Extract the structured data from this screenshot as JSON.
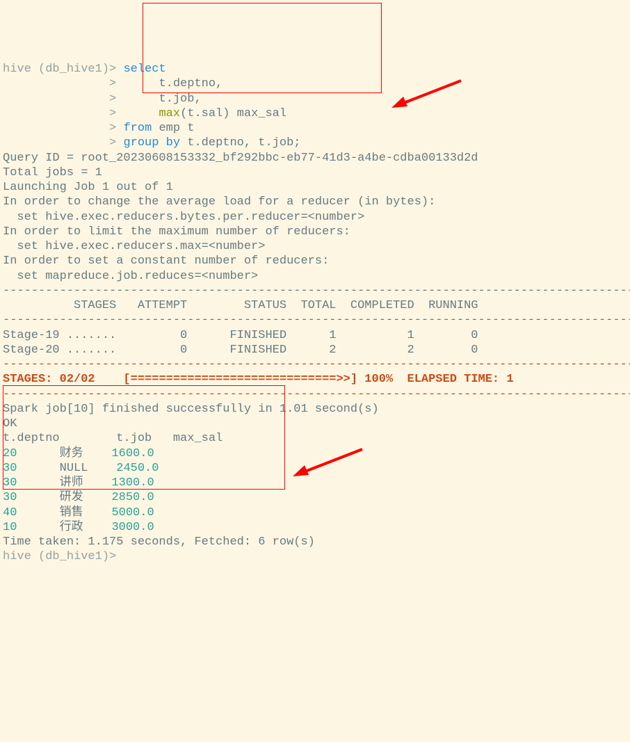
{
  "prompt": "hive (db_hive1)>",
  "cont_prompt": "               > ",
  "query": {
    "l1": "select",
    "l2": "     t.deptno,",
    "l3": "     t.job,",
    "l4_fn": "max",
    "l4_arg": "(t.sal) max_sal",
    "l5_from": "from",
    "l5_tbl": " emp t",
    "l6_grp": "group",
    "l6_by": "by",
    "l6_cols": " t.deptno, t.job;"
  },
  "exec": {
    "queryid_label": "Query ID = ",
    "queryid_val": "root_20230608153332_bf292bbc-eb77-41d3-a4be-cdba00133d2d",
    "total_jobs": "Total jobs = 1",
    "launching": "Launching Job 1 out of 1",
    "info1": "In order to change the average load for a reducer (in bytes):",
    "set1": "  set hive.exec.reducers.bytes.per.reducer=<number>",
    "info2": "In order to limit the maximum number of reducers:",
    "set2": "  set hive.exec.reducers.max=<number>",
    "info3": "In order to set a constant number of reducers:",
    "set3": "  set mapreduce.job.reduces=<number>"
  },
  "divider": "----------------------------------------------------------------------------------------------",
  "stages_hdr": "          STAGES   ATTEMPT        STATUS  TOTAL  COMPLETED  RUNNING  ",
  "stage_rows": [
    "Stage-19 .......         0      FINISHED      1          1        0",
    "Stage-20 .......         0      FINISHED      2          2        0"
  ],
  "progress": {
    "label": "STAGES: 02/02",
    "bar": "    [=============================>>] 100%  ELAPSED TIME: 1"
  },
  "spark_done": "Spark job[10] finished successfully in 1.01 second(s)",
  "ok": "OK",
  "result": {
    "header": "t.deptno        t.job   max_sal",
    "rows": [
      [
        "20",
        "财务",
        "1600.0"
      ],
      [
        "30",
        "NULL",
        "2450.0"
      ],
      [
        "30",
        "讲师",
        "1300.0"
      ],
      [
        "30",
        "研发",
        "2850.0"
      ],
      [
        "40",
        "销售",
        "5000.0"
      ],
      [
        "10",
        "行政",
        "3000.0"
      ]
    ]
  },
  "time_taken": "Time taken: 1.175 seconds, Fetched: 6 row(s)",
  "prompt_end": "hive (db_hive1)>"
}
